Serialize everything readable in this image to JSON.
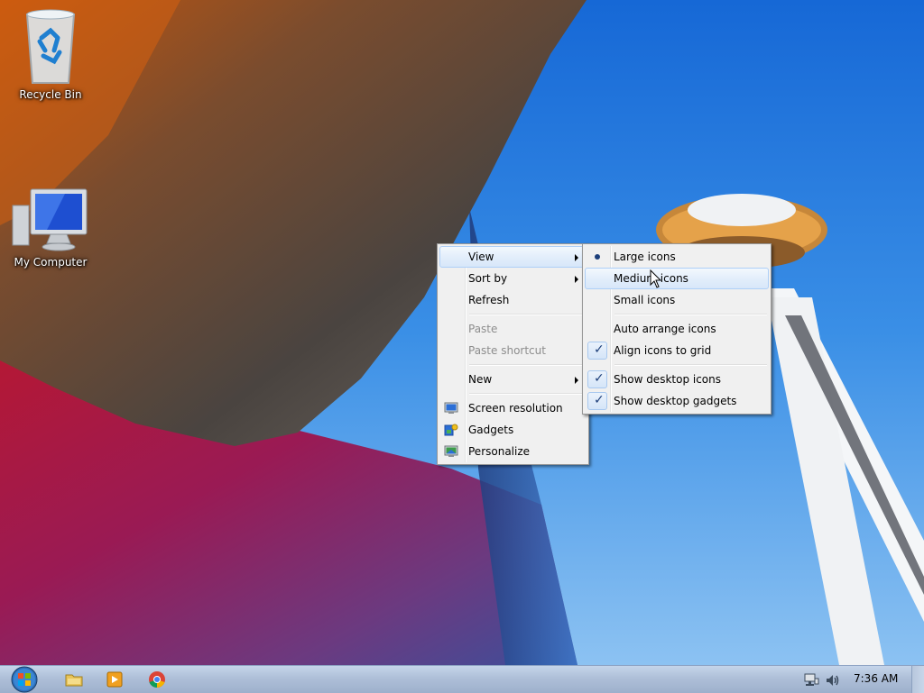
{
  "desktop": {
    "icons": [
      {
        "label": "Recycle Bin"
      },
      {
        "label": "My Computer"
      }
    ]
  },
  "context_menu": {
    "items": {
      "view": "View",
      "sort_by": "Sort by",
      "refresh": "Refresh",
      "paste": "Paste",
      "paste_shortcut": "Paste shortcut",
      "new": "New",
      "screen_resolution": "Screen resolution",
      "gadgets": "Gadgets",
      "personalize": "Personalize"
    }
  },
  "view_submenu": {
    "items": {
      "large_icons": "Large icons",
      "medium_icons": "Medium icons",
      "small_icons": "Small icons",
      "auto_arrange": "Auto arrange icons",
      "align_grid": "Align icons to grid",
      "show_desktop_icons": "Show desktop icons",
      "show_desktop_gadgets": "Show desktop gadgets"
    },
    "state": {
      "selected_size": "Large icons",
      "auto_arrange": false,
      "align_grid": true,
      "show_desktop_icons": true,
      "show_desktop_gadgets": true
    },
    "highlighted": "Medium icons"
  },
  "taskbar": {
    "pinned": [
      "start-orb-icon",
      "explorer-icon",
      "media-player-icon",
      "chrome-icon"
    ],
    "tray_icons": [
      "network-icon",
      "volume-icon"
    ],
    "clock": "7:36 AM"
  }
}
